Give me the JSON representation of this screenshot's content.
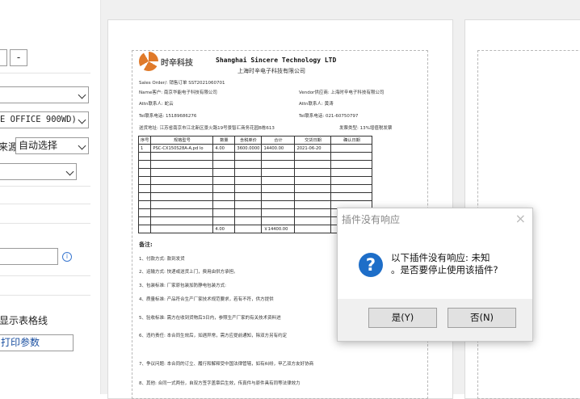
{
  "left_panel": {
    "printer_select": "E OFFICE 900WD)",
    "paper_source_label": "来源",
    "paper_source_select": "自动选择",
    "show_table_lines": "显示表格线",
    "print_params": "打印参数",
    "minus_button": "-"
  },
  "document": {
    "company_en": "Shanghai Sincere Technology LTD",
    "company_cn": "上海时辛电子科技有限公司",
    "logo_text": "时辛科技",
    "sales_order": "Sales Order/: 销售订单 SST2021060701",
    "customer": "Name客户: 南京华能电子科技有限公司",
    "vendor": "Vendor供应商: 上海时辛电子科技有限公司",
    "attn_left": "Attn联系人: 蛇云",
    "attn_right": "Attn联系人: 黄涛",
    "tel_left": "Tel联系电话: 15189686276",
    "tel_right": "Tel联系电话: 021-60750797",
    "address": "送货地址: 江苏省南京市江北新区景火路19号景智汇商务花园B栋613",
    "invoice": "发票类型: 13%增值税发票",
    "table_headers": [
      "序号",
      "规格型号",
      "数量",
      "含税单价",
      "合计",
      "交货日期",
      "确认日期"
    ],
    "row1": [
      "1",
      "PSC-CX150S28A-A,pd lo",
      "4.00",
      "3600.0000",
      "14400.00",
      "2021-06-20",
      ""
    ],
    "total_qty": "4.00",
    "total_amount": "￥14400.00",
    "remarks_title": "备注:",
    "remarks": [
      "1、付款方式: 款到发货",
      "2、运输方式: 快递或送货上门，费用由供方承担。",
      "3、包装标准: 厂家原包装加防静电包装方式:",
      "4、质量标准: 产品符合生产厂家技术规范要求，若有不符，供方提供",
      "5、验收标准: 需方在收到货物后3日内，参照生产厂家的有关技术资料进",
      "6、违约责任: 本合同生效后，如遇异常，需方应提前通知，除双方另有约定",
      "7、争议问题: 本合同的订立、履行和解释受中国法律管辖，如有纠纷，甲乙双方友好协商",
      "8、其他: 合同一式两份，自双方签字盖章后生效，传真件与原件具有同等法律效力"
    ]
  },
  "dialog": {
    "title": "插件没有响应",
    "message_line1": "以下插件没有响应: 未知",
    "message_line2": "。是否要停止使用该插件?",
    "yes_button": "是(Y)",
    "no_button": "否(N)"
  }
}
